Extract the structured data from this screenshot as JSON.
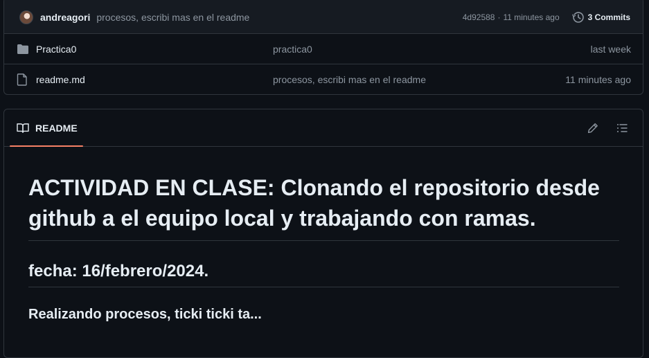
{
  "latest_commit": {
    "author": "andreagori",
    "message": "procesos, escribi mas en el readme",
    "hash": "4d92588",
    "separator": "·",
    "age": "11 minutes ago",
    "commits_count": "3 Commits"
  },
  "files": [
    {
      "name": "Practica0",
      "type": "folder",
      "commit_message": "practica0",
      "age": "last week"
    },
    {
      "name": "readme.md",
      "type": "file",
      "commit_message": "procesos, escribi mas en el readme",
      "age": "11 minutes ago"
    }
  ],
  "readme": {
    "tab_label": "README",
    "icons": [
      "book-icon",
      "pencil-icon",
      "list-icon"
    ],
    "heading1": "ACTIVIDAD EN CLASE: Clonando el repositorio desde github a el equipo local y trabajando con ramas.",
    "heading2": "fecha: 16/febrero/2024.",
    "heading3": "Realizando procesos, ticki ticki ta..."
  },
  "colors": {
    "background": "#0d1117",
    "header_background": "#161b22",
    "border": "#30363d",
    "muted_text": "#8d96a0",
    "tab_underline": "#f78166"
  }
}
